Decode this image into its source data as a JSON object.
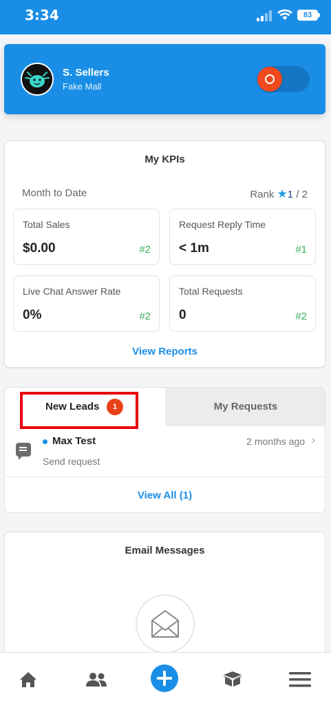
{
  "status_bar": {
    "time": "3:34",
    "battery": "83"
  },
  "profile": {
    "name": "S. Sellers",
    "store": "Fake Mall"
  },
  "kpis": {
    "title": "My KPIs",
    "period": "Month to Date",
    "rank_label": "Rank",
    "rank_value": "1",
    "rank_total": "/ 2",
    "items": [
      {
        "label": "Total Sales",
        "value": "$0.00",
        "rank": "#2"
      },
      {
        "label": "Request Reply Time",
        "value": "< 1m",
        "rank": "#1"
      },
      {
        "label": "Live Chat Answer Rate",
        "value": "0%",
        "rank": "#2"
      },
      {
        "label": "Total Requests",
        "value": "0",
        "rank": "#2"
      }
    ],
    "view_reports": "View Reports"
  },
  "leads": {
    "tabs": [
      {
        "label": "New Leads",
        "badge": "1"
      },
      {
        "label": "My Requests"
      }
    ],
    "items": [
      {
        "name": "Max Test",
        "time": "2 months ago",
        "subtitle": "Send request"
      }
    ],
    "view_all": "View All (1)"
  },
  "email": {
    "title": "Email Messages"
  },
  "nav": {
    "items": [
      {
        "icon": "home-icon"
      },
      {
        "icon": "people-icon"
      },
      {
        "icon": "add-icon"
      },
      {
        "icon": "box-icon"
      },
      {
        "icon": "menu-icon"
      }
    ]
  },
  "colors": {
    "primary": "#1a8ee6",
    "badge": "#e84118",
    "rank_green": "#3aad5a",
    "highlight": "#e8000e"
  }
}
